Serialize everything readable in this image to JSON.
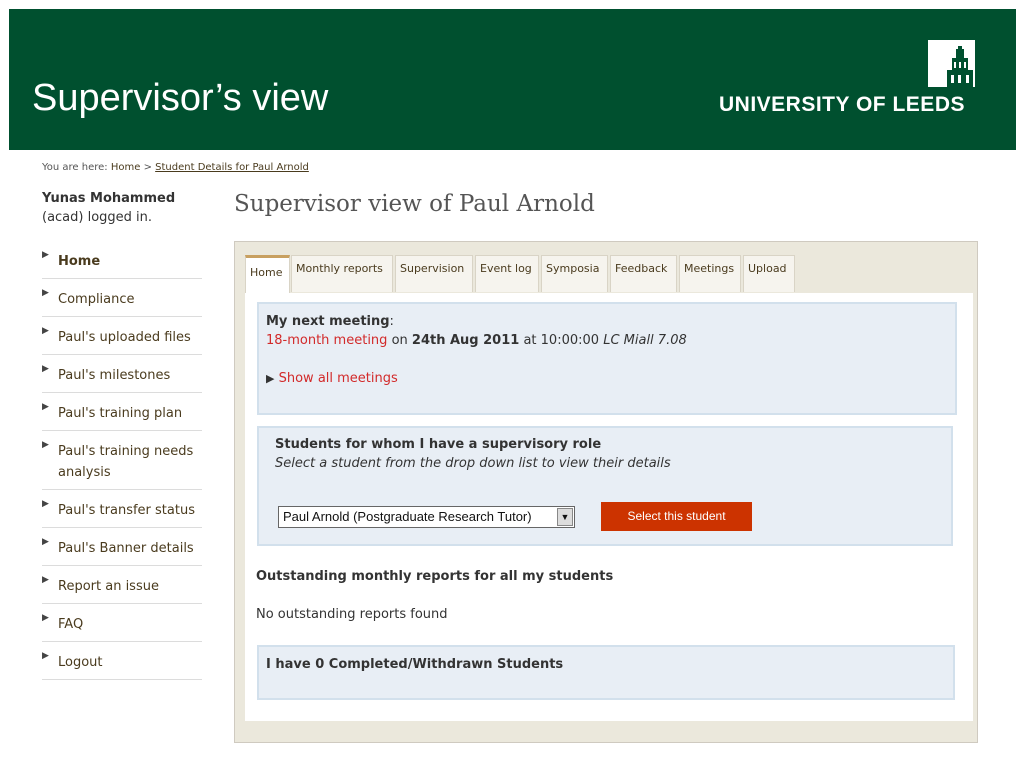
{
  "slide": {
    "title": "Supervisor’s view",
    "logo_text": "UNIVERSITY OF LEEDS"
  },
  "breadcrumb": {
    "prefix": "You are here:",
    "home": "Home",
    "separator": ">",
    "current": "Student Details for Paul Arnold"
  },
  "user": {
    "name": "Yunas Mohammed",
    "status": "(acad) logged in."
  },
  "nav": {
    "items": [
      {
        "label": "Home"
      },
      {
        "label": "Compliance"
      },
      {
        "label": "Paul's uploaded files"
      },
      {
        "label": "Paul's milestones"
      },
      {
        "label": "Paul's training plan"
      },
      {
        "label": "Paul's training needs analysis"
      },
      {
        "label": "Paul's transfer status"
      },
      {
        "label": "Paul's Banner details"
      },
      {
        "label": "Report an issue"
      },
      {
        "label": "FAQ"
      },
      {
        "label": "Logout"
      }
    ]
  },
  "page": {
    "heading": "Supervisor view of Paul Arnold"
  },
  "tabs": [
    {
      "label": "Home"
    },
    {
      "label": "Monthly reports"
    },
    {
      "label": "Supervision"
    },
    {
      "label": "Event log"
    },
    {
      "label": "Symposia"
    },
    {
      "label": "Feedback"
    },
    {
      "label": "Meetings"
    },
    {
      "label": "Upload"
    }
  ],
  "next_meeting": {
    "title": "My next meeting",
    "colon": ":",
    "meeting_name": "18-month meeting",
    "on": "on",
    "date": "24th Aug 2011",
    "at": "at 10:00:00",
    "location": "LC Miall 7.08",
    "show_all": "Show all meetings"
  },
  "students": {
    "title": "Students for whom I have a supervisory role",
    "hint": "Select a student from the drop down list to view their details",
    "selected": "Paul Arnold (Postgraduate Research Tutor)",
    "button": "Select this student"
  },
  "outstanding": {
    "title": "Outstanding monthly reports for all my students",
    "empty": "No outstanding reports found"
  },
  "completed": {
    "title": "I have 0 Completed/Withdrawn Students"
  },
  "colors": {
    "brand_green": "#00502f",
    "accent_red": "#cc3300"
  }
}
